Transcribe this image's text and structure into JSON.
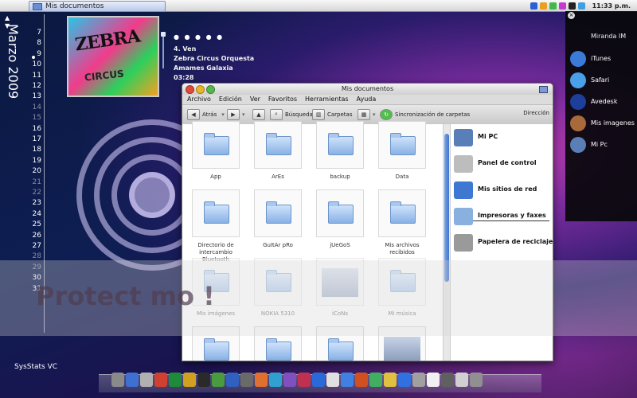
{
  "menubar": {
    "apple_glyph": "",
    "task_title": "Mis documentos",
    "clock": "11:33 p.m.",
    "tray_colors": [
      "#2b5fd6",
      "#e8a020",
      "#41b94a",
      "#c63ad0",
      "#222222",
      "#3fa0e0"
    ]
  },
  "calendar": {
    "month": "Marzo 2009",
    "arrows": "▲\n▼",
    "days": [
      {
        "n": "7",
        "dim": false
      },
      {
        "n": "8",
        "dim": false
      },
      {
        "n": "9",
        "dim": false
      },
      {
        "n": "10",
        "dim": false
      },
      {
        "n": "11",
        "dim": false
      },
      {
        "n": "12",
        "dim": false
      },
      {
        "n": "13",
        "dim": false
      },
      {
        "n": "14",
        "dim": true
      },
      {
        "n": "15",
        "dim": true
      },
      {
        "n": "16",
        "dim": false
      },
      {
        "n": "17",
        "dim": false
      },
      {
        "n": "18",
        "dim": false
      },
      {
        "n": "19",
        "dim": false
      },
      {
        "n": "20",
        "dim": false
      },
      {
        "n": "21",
        "dim": true
      },
      {
        "n": "22",
        "dim": true
      },
      {
        "n": "23",
        "dim": false
      },
      {
        "n": "24",
        "dim": false
      },
      {
        "n": "25",
        "dim": false
      },
      {
        "n": "26",
        "dim": false
      },
      {
        "n": "27",
        "dim": false
      },
      {
        "n": "28",
        "dim": true
      },
      {
        "n": "29",
        "dim": true
      },
      {
        "n": "30",
        "dim": false
      },
      {
        "n": "31",
        "dim": false
      }
    ]
  },
  "music": {
    "cover_title": "ZEBRA",
    "cover_subtitle": "CIRCUS",
    "rating": "● ● ● ● ●",
    "track": "4. Ven",
    "artist": "Zebra Circus Orquesta",
    "album": "Amames Galaxia",
    "time": "03:28"
  },
  "window": {
    "title": "Mis documentos",
    "menu": [
      "Archivo",
      "Edición",
      "Ver",
      "Favoritos",
      "Herramientas",
      "Ayuda"
    ],
    "toolbar": {
      "back": "Atrás",
      "search": "Búsqueda",
      "folders": "Carpetas",
      "sync": "Sincronización de carpetas",
      "address": "Dirección"
    },
    "items": [
      {
        "label": "App",
        "type": "folder",
        "faded": false
      },
      {
        "label": "ArEs",
        "type": "folder",
        "faded": false
      },
      {
        "label": "backup",
        "type": "folder",
        "faded": false
      },
      {
        "label": "Data",
        "type": "folder",
        "faded": false
      },
      {
        "label": "Directorio de intercambio Bluetooth",
        "type": "folder",
        "faded": false
      },
      {
        "label": "GuItAr pRo",
        "type": "folder",
        "faded": false
      },
      {
        "label": "jUeGoS",
        "type": "folder",
        "faded": false
      },
      {
        "label": "Mis archivos recibidos",
        "type": "folder",
        "faded": false
      },
      {
        "label": "Mis imágenes",
        "type": "folder",
        "faded": true
      },
      {
        "label": "NOKIA 5310",
        "type": "folder",
        "faded": true
      },
      {
        "label": "iCoNs",
        "type": "thumb",
        "faded": true
      },
      {
        "label": "Mi música",
        "type": "folder",
        "faded": true
      },
      {
        "label": "",
        "type": "folder",
        "faded": false
      },
      {
        "label": "",
        "type": "folder",
        "faded": false
      },
      {
        "label": "",
        "type": "folder",
        "faded": false
      },
      {
        "label": "",
        "type": "thumb",
        "faded": false
      }
    ],
    "side": [
      {
        "label": "Mi PC",
        "icon": "computer-icon",
        "color": "#5a7fb8"
      },
      {
        "label": "Panel de control",
        "icon": "control-panel-icon",
        "color": "#bdbdbd"
      },
      {
        "label": "Mis sitios de red",
        "icon": "network-icon",
        "color": "#3f78d0"
      },
      {
        "label": "Impresoras y faxes",
        "icon": "printer-folder-icon",
        "color": "#8ab0e0"
      },
      {
        "label": "Papelera de reciclaje",
        "icon": "trash-icon",
        "color": "#9a9a9a"
      }
    ]
  },
  "miranda": {
    "title": "Miranda IM",
    "items": [
      {
        "label": "iTunes",
        "icon": "itunes-icon",
        "color": "#3a7bd8"
      },
      {
        "label": "Safari",
        "icon": "safari-icon",
        "color": "#4aa0e8"
      },
      {
        "label": "Avedesk",
        "icon": "avedesk-icon",
        "color": "#1d3f9a"
      },
      {
        "label": "Mis imagenes",
        "icon": "pictures-icon",
        "color": "#a86a3a"
      },
      {
        "label": "Mi Pc",
        "icon": "computer-icon",
        "color": "#5a7fb8"
      }
    ]
  },
  "watermark": "Protect mo                                                                     !",
  "sysstats": "SysStats VC",
  "dock_colors": [
    "#8a8a8a",
    "#3f6fd0",
    "#b0b0b0",
    "#d04030",
    "#1f8a3a",
    "#d0a020",
    "#2a2a2a",
    "#4a9a40",
    "#3060c0",
    "#6a6a6a",
    "#e07030",
    "#30a0d0",
    "#8050c0",
    "#c03050",
    "#2a6ad8",
    "#e0e0e0",
    "#4080e0",
    "#d05020",
    "#40b060",
    "#e0c040",
    "#3070e0",
    "#a0a0a0",
    "#f0f0f0",
    "#606060",
    "#d0d0d0",
    "#909090"
  ]
}
